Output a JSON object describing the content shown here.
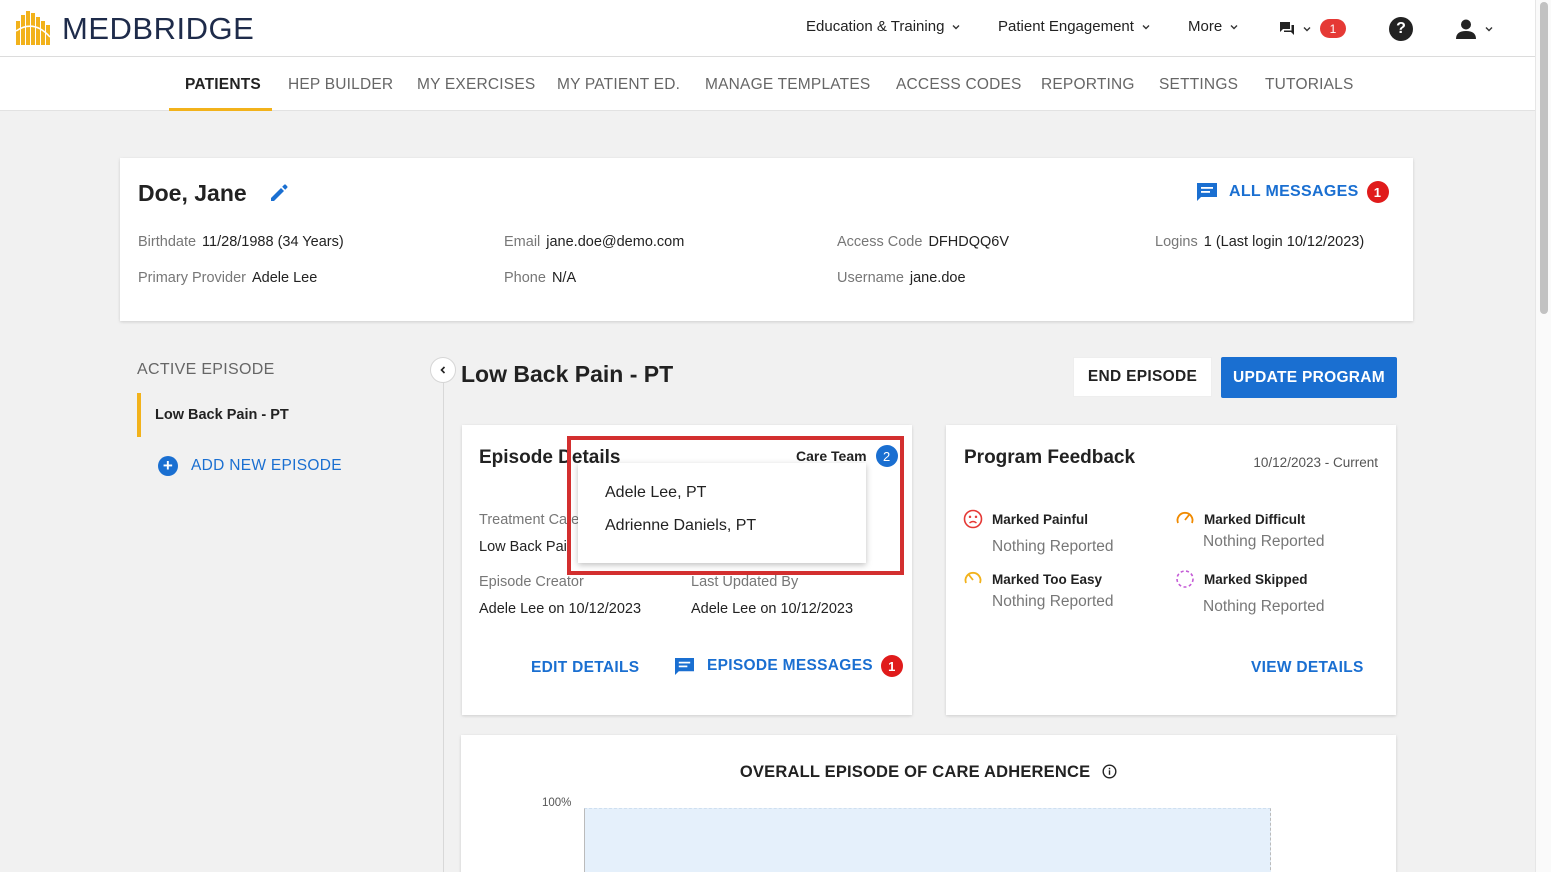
{
  "brand": {
    "name": "MEDBRIDGE",
    "color": "#f2b21b"
  },
  "topnav": {
    "education": "Education & Training",
    "engagement": "Patient Engagement",
    "more": "More",
    "chat_count": "1"
  },
  "subnav": {
    "items": [
      "PATIENTS",
      "HEP BUILDER",
      "MY EXERCISES",
      "MY PATIENT ED.",
      "MANAGE TEMPLATES",
      "ACCESS CODES",
      "REPORTING",
      "SETTINGS",
      "TUTORIALS"
    ],
    "active": "PATIENTS"
  },
  "patient": {
    "name": "Doe, Jane",
    "all_messages": "ALL MESSAGES",
    "all_messages_count": "1",
    "birthdate_label": "Birthdate",
    "birthdate": "11/28/1988 (34 Years)",
    "provider_label": "Primary Provider",
    "provider": "Adele Lee",
    "email_label": "Email",
    "email": "jane.doe@demo.com",
    "phone_label": "Phone",
    "phone": "N/A",
    "access_label": "Access Code",
    "access": "DFHDQQ6V",
    "username_label": "Username",
    "username": "jane.doe",
    "logins_label": "Logins",
    "logins": "1 (Last login 10/12/2023)"
  },
  "sidebar": {
    "title": "ACTIVE EPISODE",
    "episode": "Low Back Pain - PT",
    "add_episode": "ADD NEW EPISODE"
  },
  "episode": {
    "title": "Low Back Pain - PT",
    "end_button": "END EPISODE",
    "update_button": "UPDATE PROGRAM"
  },
  "details": {
    "title": "Episode Details",
    "care_team_label": "Care Team",
    "care_team_count": "2",
    "treatment_label": "Treatment Cate",
    "treatment_value": "Low Back Pai",
    "creator_label": "Episode Creator",
    "creator_value": "Adele Lee on 10/12/2023",
    "updated_label": "Last Updated By",
    "updated_value": "Adele Lee on 10/12/2023",
    "edit_link": "EDIT DETAILS",
    "messages_link": "EPISODE MESSAGES",
    "messages_count": "1"
  },
  "care_team": [
    "Adele Lee, PT",
    "Adrienne Daniels, PT"
  ],
  "feedback": {
    "title": "Program Feedback",
    "date_range": "10/12/2023 - Current",
    "painful": "Marked Painful",
    "painful_value": "Nothing Reported",
    "difficult": "Marked Difficult",
    "difficult_value": "Nothing Reported",
    "easy": "Marked Too Easy",
    "easy_value": "Nothing Reported",
    "skipped": "Marked Skipped",
    "skipped_value": "Nothing Reported",
    "view_link": "VIEW DETAILS"
  },
  "adherence": {
    "title": "OVERALL EPISODE OF CARE ADHERENCE",
    "y_tick_top": "100%"
  },
  "colors": {
    "primary": "#1a6fd1",
    "accent": "#f2b21b",
    "alert": "#e01b1b",
    "highlight_border": "#d32f2f"
  }
}
